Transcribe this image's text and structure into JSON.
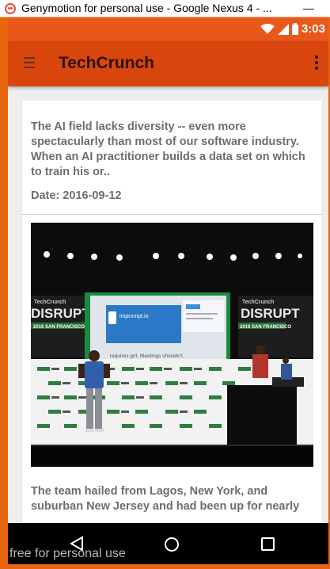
{
  "window": {
    "title": "Genymotion for personal use - Google Nexus 4 - ...",
    "minimize_label": "—"
  },
  "statusbar": {
    "time": "3:03",
    "icons": [
      "wifi-icon",
      "signal-icon",
      "battery-icon"
    ]
  },
  "appbar": {
    "title": "TechCrunch",
    "menu_icon": "hamburger-menu-icon",
    "more_icon": "more-vert-icon"
  },
  "article": {
    "summary": "The AI field lacks diversity -- even more spectacularly than most of our software industry. When an AI practitioner builds a data set on which to train his or..",
    "date": "Date: 2016-09-12",
    "image": {
      "brand_left": "TechCrunch",
      "event_left": "DISRUPT",
      "city_left": "2016 SAN FRANCISCO",
      "brand_right": "TechCrunch",
      "event_right": "DISRUPT",
      "city_right": "2016 SAN FRANCISCO",
      "screen_brand": "imprompt.io",
      "screen_tagline": "requires grit. Meetings shouldn't."
    },
    "body": "The team hailed from Lagos, New York, and suburban New Jersey and had been up for nearly"
  },
  "navbar": {
    "buttons": [
      "back-icon",
      "home-icon",
      "recents-icon"
    ]
  },
  "watermark": "free for personal use",
  "colors": {
    "statusbar": "#e8581a",
    "appbar": "#d8460e",
    "frame": "#e8650f",
    "text_gray": "#6d6d6d"
  }
}
